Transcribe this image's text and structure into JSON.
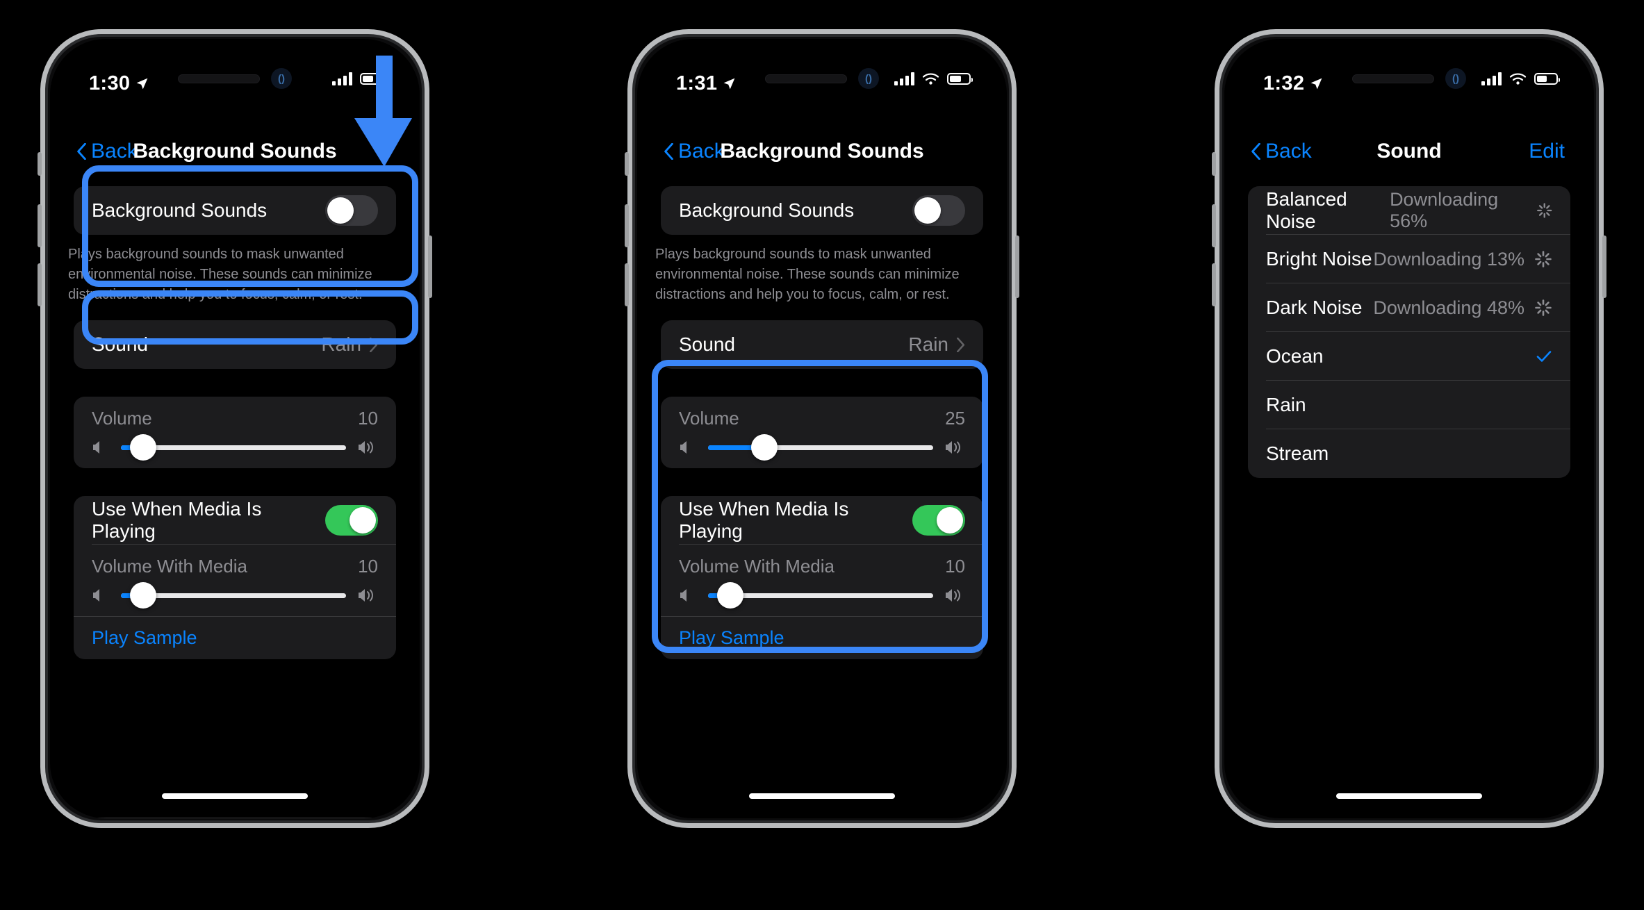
{
  "phones": [
    {
      "id": "phone-1",
      "status": {
        "time": "1:30",
        "location_icon": "location-arrow-icon",
        "signal_icon": "cellular-bars-icon",
        "battery_icon": "battery-icon"
      },
      "nav": {
        "back": "Back",
        "title": "Background Sounds",
        "edit": ""
      },
      "toggle_row": {
        "label": "Background Sounds",
        "state": "off"
      },
      "description": "Plays background sounds to mask unwanted environmental noise. These sounds can minimize distractions and help you to focus, calm, or rest.",
      "sound_row": {
        "label": "Sound",
        "value": "Rain",
        "chevron": "chevron-right-icon"
      },
      "volume": {
        "label": "Volume",
        "value": "10",
        "percent": 10
      },
      "media_toggle": {
        "label": "Use When Media Is Playing",
        "state": "on"
      },
      "media_volume": {
        "label": "Volume With Media",
        "value": "10",
        "percent": 10
      },
      "play_sample": "Play Sample",
      "annotations": {
        "arrow": "down-arrow-annotation",
        "highlight_sound": true,
        "highlight_toggle": true
      }
    },
    {
      "id": "phone-2",
      "status": {
        "time": "1:31",
        "location_icon": "location-arrow-icon",
        "signal_icon": "cellular-bars-icon",
        "wifi_icon": "wifi-icon",
        "battery_icon": "battery-icon"
      },
      "nav": {
        "back": "Back",
        "title": "Background Sounds",
        "edit": ""
      },
      "toggle_row": {
        "label": "Background Sounds",
        "state": "off"
      },
      "description": "Plays background sounds to mask unwanted environmental noise. These sounds can minimize distractions and help you to focus, calm, or rest.",
      "sound_row": {
        "label": "Sound",
        "value": "Rain",
        "chevron": "chevron-right-icon"
      },
      "volume": {
        "label": "Volume",
        "value": "25",
        "percent": 25
      },
      "media_toggle": {
        "label": "Use When Media Is Playing",
        "state": "on"
      },
      "media_volume": {
        "label": "Volume With Media",
        "value": "10",
        "percent": 10
      },
      "play_sample": "Play Sample",
      "annotations": {
        "highlight_volume_block": true
      }
    },
    {
      "id": "phone-3",
      "status": {
        "time": "1:32",
        "location_icon": "location-arrow-icon",
        "signal_icon": "cellular-bars-icon",
        "wifi_icon": "wifi-icon",
        "battery_icon": "battery-icon"
      },
      "nav": {
        "back": "Back",
        "title": "Sound",
        "edit": "Edit"
      },
      "sounds": [
        {
          "name": "Balanced Noise",
          "status": "Downloading 56%",
          "spinner": true,
          "selected": false
        },
        {
          "name": "Bright Noise",
          "status": "Downloading 13%",
          "spinner": true,
          "selected": false
        },
        {
          "name": "Dark Noise",
          "status": "Downloading 48%",
          "spinner": true,
          "selected": false
        },
        {
          "name": "Ocean",
          "status": "",
          "spinner": false,
          "selected": true
        },
        {
          "name": "Rain",
          "status": "",
          "spinner": false,
          "selected": false
        },
        {
          "name": "Stream",
          "status": "",
          "spinner": false,
          "selected": false
        }
      ]
    }
  ],
  "colors": {
    "accent_blue": "#0a84ff",
    "highlight_blue": "#3b86f7",
    "toggle_on_green": "#34c759",
    "group_bg": "#1c1c1e",
    "secondary_text": "#8e8e93"
  }
}
